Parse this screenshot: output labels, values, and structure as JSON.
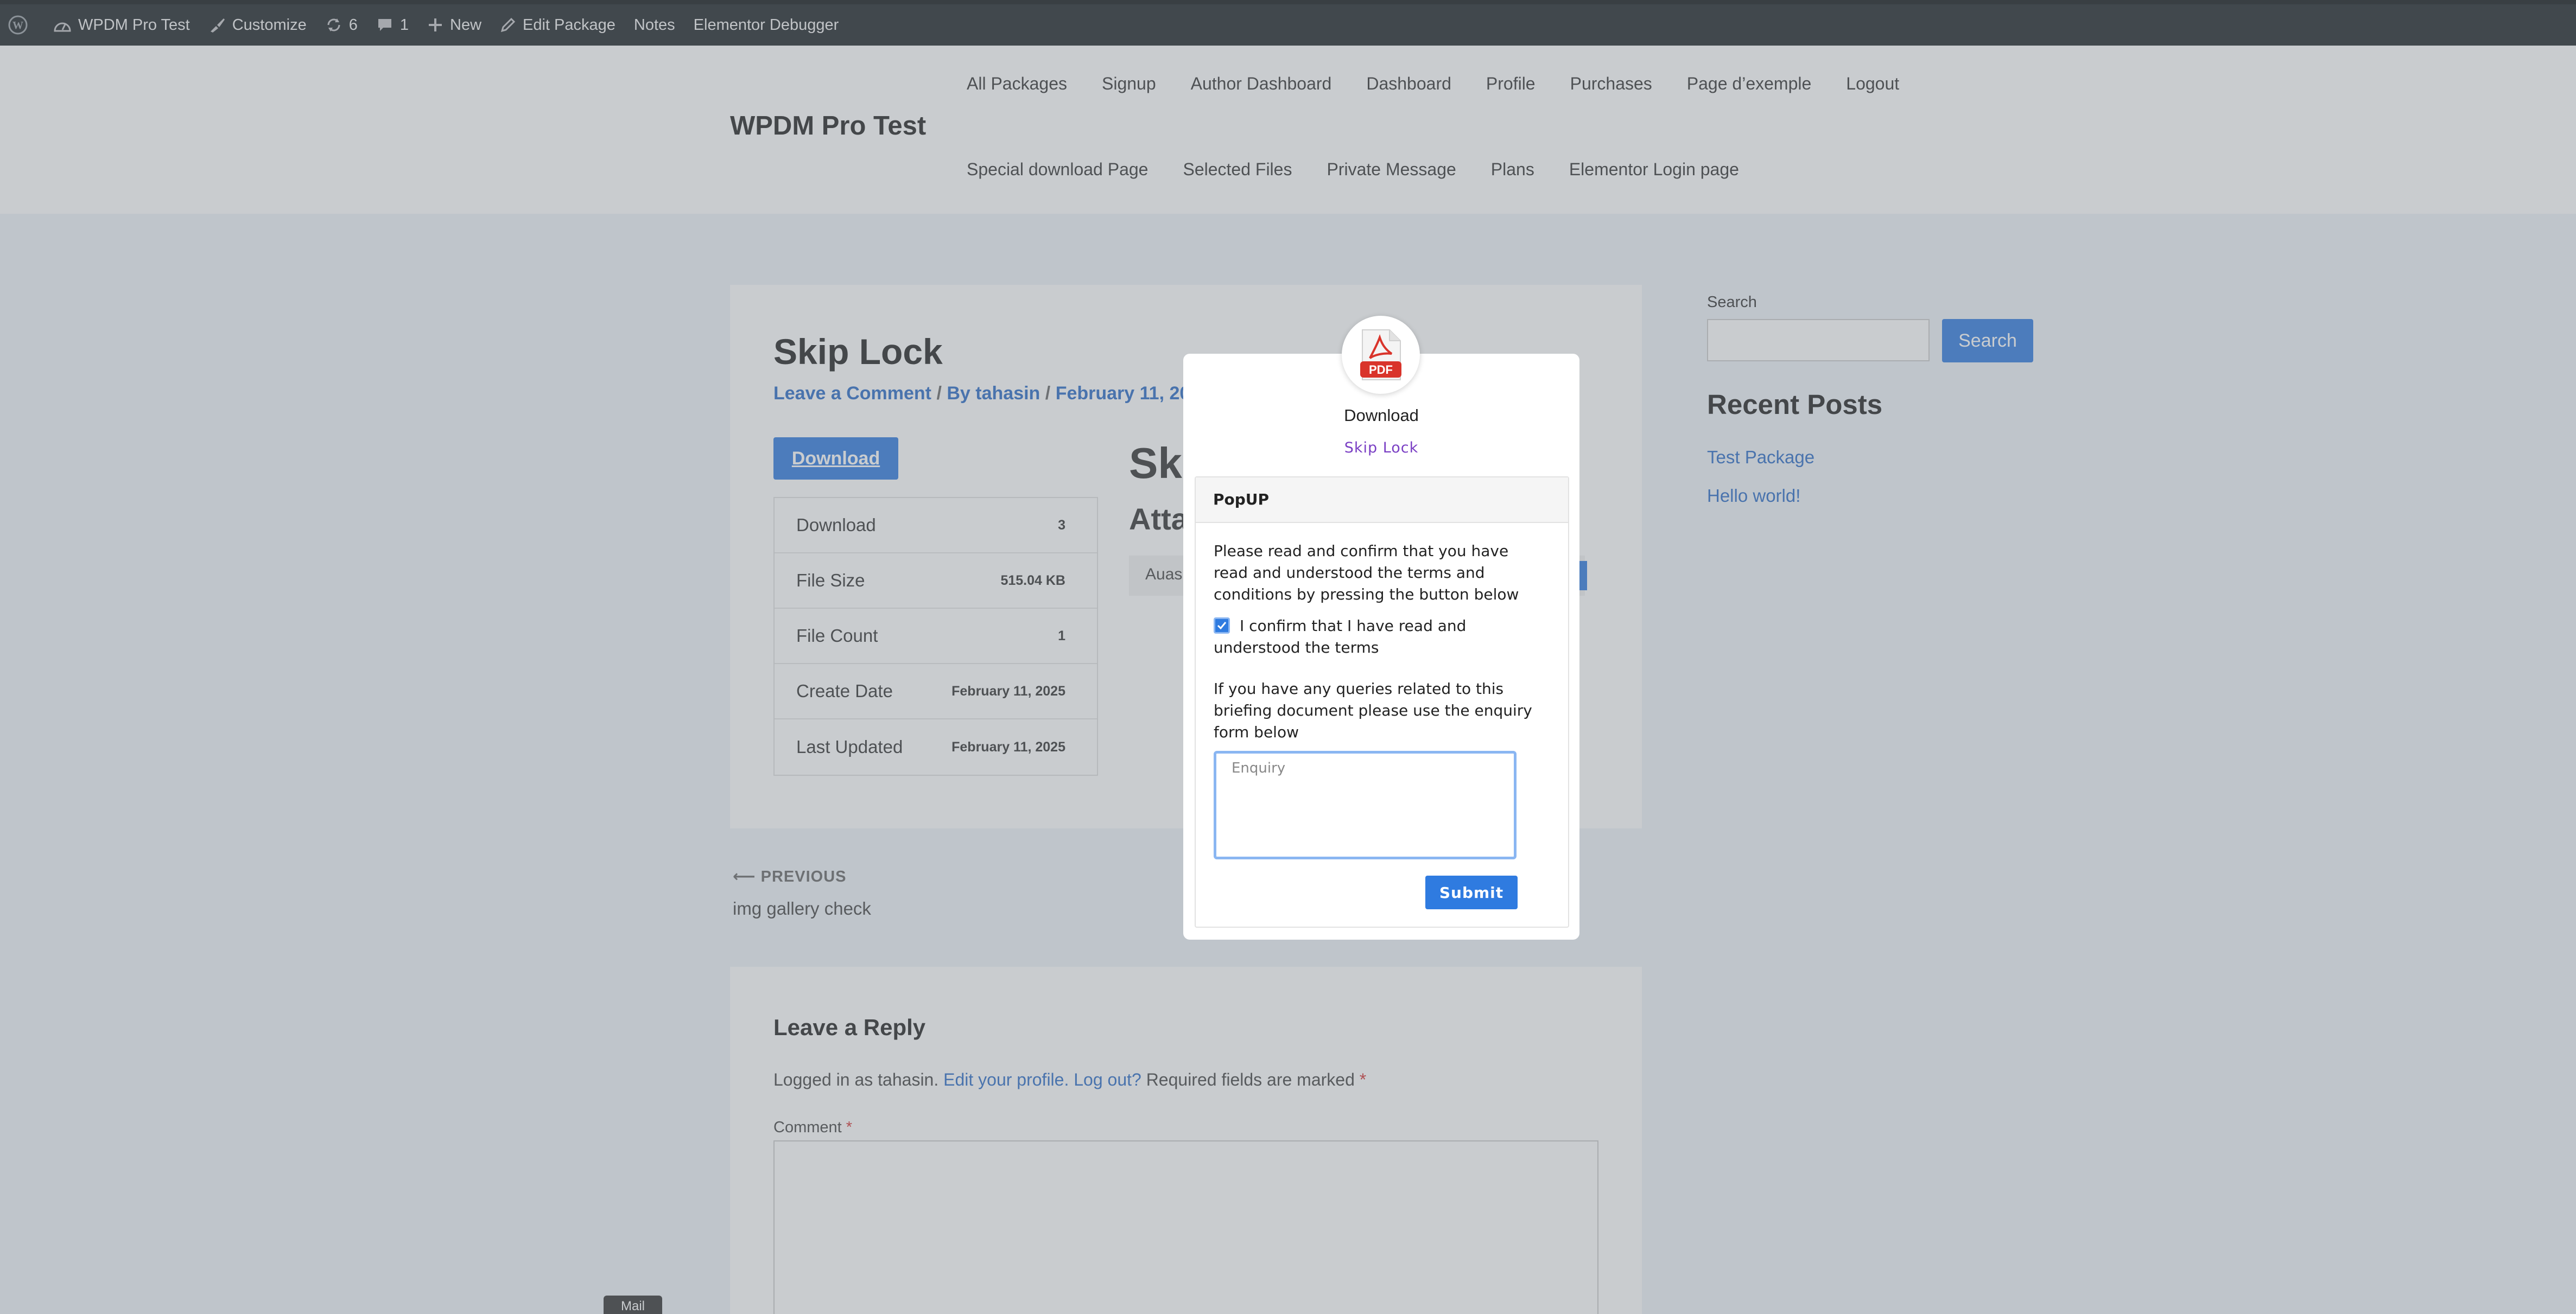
{
  "admin_bar": {
    "site_name": "WPDM Pro Test",
    "customize": "Customize",
    "updates_count": "6",
    "comments_count": "1",
    "new": "New",
    "edit_package": "Edit Package",
    "notes": "Notes",
    "elementor_debugger": "Elementor Debugger"
  },
  "header": {
    "site_title": "WPDM Pro Test",
    "nav_row1": [
      "All Packages",
      "Signup",
      "Author Dashboard",
      "Dashboard",
      "Profile",
      "Purchases",
      "Page d’exemple",
      "Logout"
    ],
    "nav_row2": [
      "Special download Page",
      "Selected Files",
      "Private Message",
      "Plans",
      "Elementor Login page"
    ]
  },
  "post": {
    "title": "Skip Lock",
    "meta": {
      "comment_link": "Leave a Comment",
      "by": "By",
      "author": "tahasin",
      "date": "February 11, 2025"
    },
    "download_button": "Download",
    "info_rows": [
      {
        "label": "Download",
        "value": "3"
      },
      {
        "label": "File Size",
        "value": "515.04 KB"
      },
      {
        "label": "File Count",
        "value": "1"
      },
      {
        "label": "Create Date",
        "value": "February 11, 2025"
      },
      {
        "label": "Last Updated",
        "value": "February 11, 2025"
      }
    ],
    "side_heading": "Ski",
    "attachments_heading": "Atta",
    "attachment_name": "Auas"
  },
  "post_nav": {
    "previous_label": "PREVIOUS",
    "previous_title": "img gallery check"
  },
  "reply": {
    "title": "Leave a Reply",
    "logged_in": "Logged in as tahasin.",
    "edit_profile": "Edit your profile.",
    "log_out": "Log out?",
    "required_text": "Required fields are marked",
    "required_mark": "*",
    "comment_label": "Comment"
  },
  "sidebar": {
    "search_label": "Search",
    "search_button": "Search",
    "recent_title": "Recent Posts",
    "recent_posts": [
      "Test Package",
      "Hello world!"
    ]
  },
  "tooltip": {
    "mail": "Mail"
  },
  "modal": {
    "icon_label": "PDF",
    "title": "Download",
    "subtitle": "Skip Lock",
    "panel_title": "PopUP",
    "instruction": "Please read and confirm that you have read and understood the terms and conditions by pressing the button below",
    "checkbox_label": "I confirm that I have read and understood the terms",
    "checkbox_checked": true,
    "query_text": "If you have any queries related to this briefing document please use the enquiry form below",
    "enquiry_placeholder": "Enquiry",
    "submit_label": "Submit"
  },
  "colors": {
    "accent": "#2f7be0",
    "link": "#2a6bc7",
    "admin_bar": "#1d2327",
    "subtitle": "#7a3fc4",
    "pdf_red": "#d9342b"
  }
}
